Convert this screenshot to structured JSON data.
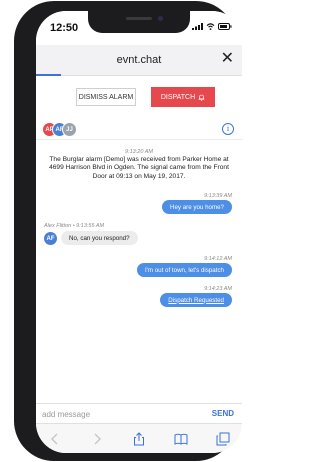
{
  "status_bar": {
    "time": "12:50"
  },
  "browser": {
    "url": "evnt.chat",
    "close_glyph": "✕",
    "load_progress_pct": 12
  },
  "actions": {
    "dismiss_label": "DISMISS ALARM",
    "dispatch_label": "DISPATCH",
    "dispatch_icon": "bell-icon",
    "dispatch_color": "#e5484d"
  },
  "participants": [
    {
      "initials": "AP",
      "color": "#e5484d"
    },
    {
      "initials": "AF",
      "color": "#4a7fd6"
    },
    {
      "initials": "JJ",
      "color": "#9aa3ad"
    }
  ],
  "info_glyph": "i",
  "messages": {
    "system": {
      "time": "9:13:20 AM",
      "text": "The Burglar alarm [Demo] was received from Parker Home at 4699 Harrison Blvd in Ogden. The signal came from the Front Door at 09:13 on May 19, 2017."
    },
    "m1": {
      "time": "9:13:39 AM",
      "text": "Hey are you home?"
    },
    "m2": {
      "meta": "Alex Flitton • 9:13:55 AM",
      "initials": "AF",
      "text": "No, can you respond?"
    },
    "m3": {
      "time": "9:14:12 AM",
      "text": "I'm out of town, let's dispatch"
    },
    "m4": {
      "time": "9:14:23 AM",
      "text": "Dispatch Requested"
    }
  },
  "composer": {
    "placeholder": "add message",
    "send_label": "SEND"
  },
  "toolbar": {
    "items": [
      "back-icon",
      "forward-icon",
      "share-icon",
      "bookmarks-icon",
      "tabs-icon"
    ]
  },
  "colors": {
    "accent": "#3b73d8",
    "outgoing_bubble": "#4d8ee6",
    "incoming_bubble": "#ececec"
  }
}
